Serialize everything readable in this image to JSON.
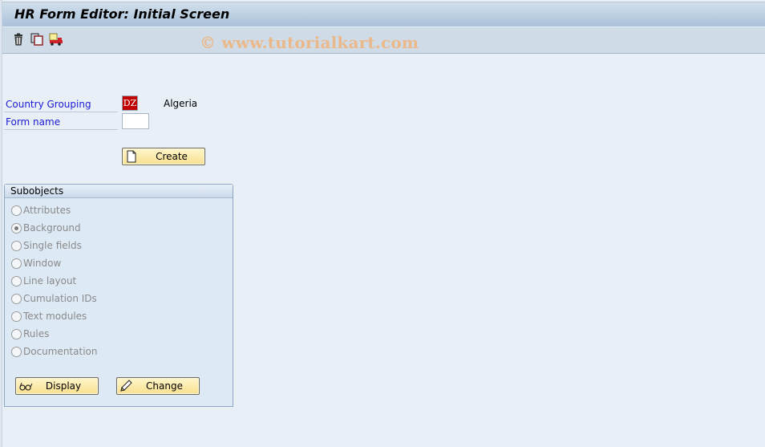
{
  "window": {
    "title": "HR Form Editor: Initial Screen"
  },
  "toolbar": {
    "items": [
      {
        "name": "delete",
        "icon": "trash-icon"
      },
      {
        "name": "copy",
        "icon": "copy-icon"
      },
      {
        "name": "transport",
        "icon": "truck-icon"
      }
    ],
    "watermark": "© www.tutorialkart.com"
  },
  "form": {
    "country_grouping_label": "Country Grouping",
    "country_grouping_value": "DZ",
    "country_grouping_text": "Algeria",
    "form_name_label": "Form name",
    "form_name_value": "",
    "create_label": "Create"
  },
  "subobjects": {
    "title": "Subobjects",
    "options": [
      {
        "label": "Attributes",
        "checked": false
      },
      {
        "label": "Background",
        "checked": true
      },
      {
        "label": "Single fields",
        "checked": false
      },
      {
        "label": "Window",
        "checked": false
      },
      {
        "label": "Line layout",
        "checked": false
      },
      {
        "label": "Cumulation IDs",
        "checked": false
      },
      {
        "label": "Text modules",
        "checked": false
      },
      {
        "label": "Rules",
        "checked": false
      },
      {
        "label": "Documentation",
        "checked": false
      }
    ],
    "display_label": "Display",
    "change_label": "Change"
  },
  "colors": {
    "country_field_bg": "#c00000",
    "label_color": "#1b1bd6",
    "button_bg": "#f8e08e"
  }
}
